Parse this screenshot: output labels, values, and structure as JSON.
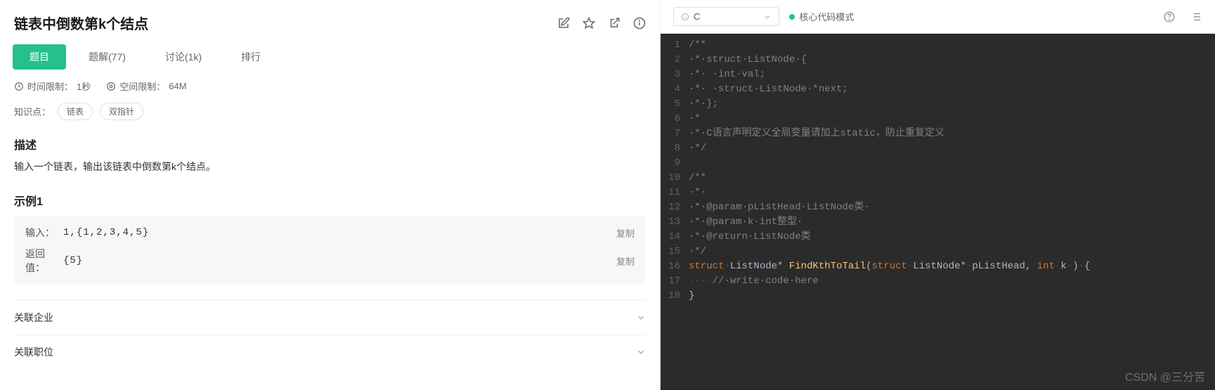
{
  "header": {
    "title": "链表中倒数第k个结点"
  },
  "tabs": [
    {
      "label": "题目",
      "active": true
    },
    {
      "label": "题解(77)",
      "active": false
    },
    {
      "label": "讨论(1k)",
      "active": false
    },
    {
      "label": "排行",
      "active": false
    }
  ],
  "limits": {
    "time_label": "时间限制：",
    "time_value": "1秒",
    "space_label": "空间限制：",
    "space_value": "64M"
  },
  "knowledge": {
    "label": "知识点：",
    "tags": [
      "链表",
      "双指针"
    ]
  },
  "description": {
    "heading": "描述",
    "text": "输入一个链表，输出该链表中倒数第k个结点。"
  },
  "example": {
    "heading": "示例1",
    "input_label": "输入：",
    "input_value": "1,{1,2,3,4,5}",
    "return_label": "返回值：",
    "return_value": "{5}",
    "copy_label": "复制"
  },
  "accordions": [
    "关联企业",
    "关联职位"
  ],
  "toolbar": {
    "language": "C",
    "mode_label": "核心代码模式"
  },
  "code": {
    "lines": [
      {
        "n": 1,
        "tokens": [
          {
            "t": "/**",
            "c": "cm"
          }
        ]
      },
      {
        "n": 2,
        "tokens": [
          {
            "t": "·*·struct·ListNode·{",
            "c": "cm"
          }
        ]
      },
      {
        "n": 3,
        "tokens": [
          {
            "t": "·*· ·int·val;",
            "c": "cm"
          }
        ]
      },
      {
        "n": 4,
        "tokens": [
          {
            "t": "·*· ·struct·ListNode·*next;",
            "c": "cm"
          }
        ]
      },
      {
        "n": 5,
        "tokens": [
          {
            "t": "·*·};",
            "c": "cm"
          }
        ]
      },
      {
        "n": 6,
        "tokens": [
          {
            "t": "·*",
            "c": "cm"
          }
        ]
      },
      {
        "n": 7,
        "tokens": [
          {
            "t": "·*·C语言声明定义全局变量请加上static，防止重复定义",
            "c": "cm"
          }
        ]
      },
      {
        "n": 8,
        "tokens": [
          {
            "t": "·*/",
            "c": "cm"
          }
        ]
      },
      {
        "n": 9,
        "tokens": [
          {
            "t": "",
            "c": "cm"
          }
        ]
      },
      {
        "n": 10,
        "tokens": [
          {
            "t": "/**",
            "c": "cm"
          }
        ]
      },
      {
        "n": 11,
        "tokens": [
          {
            "t": "·*·",
            "c": "cm"
          }
        ]
      },
      {
        "n": 12,
        "tokens": [
          {
            "t": "·*·@param·pListHead·ListNode类·",
            "c": "cm"
          }
        ]
      },
      {
        "n": 13,
        "tokens": [
          {
            "t": "·*·@param·k·int整型·",
            "c": "cm"
          }
        ]
      },
      {
        "n": 14,
        "tokens": [
          {
            "t": "·*·@return·ListNode类",
            "c": "cm"
          }
        ]
      },
      {
        "n": 15,
        "tokens": [
          {
            "t": "·*/",
            "c": "cm"
          }
        ]
      },
      {
        "n": 16,
        "tokens": [
          {
            "t": "struct",
            "c": "kw"
          },
          {
            "t": "·",
            "c": "sep"
          },
          {
            "t": "ListNode*",
            "c": "type"
          },
          {
            "t": "·",
            "c": "sep"
          },
          {
            "t": "FindKthToTail",
            "c": "fn"
          },
          {
            "t": "(",
            "c": "punc"
          },
          {
            "t": "struct",
            "c": "kw"
          },
          {
            "t": "·",
            "c": "sep"
          },
          {
            "t": "ListNode*",
            "c": "type"
          },
          {
            "t": "·",
            "c": "sep"
          },
          {
            "t": "pListHead",
            "c": "id"
          },
          {
            "t": ",",
            "c": "punc"
          },
          {
            "t": "·",
            "c": "sep"
          },
          {
            "t": "int",
            "c": "kw"
          },
          {
            "t": "·",
            "c": "sep"
          },
          {
            "t": "k",
            "c": "id"
          },
          {
            "t": "·",
            "c": "sep"
          },
          {
            "t": ")",
            "c": "punc"
          },
          {
            "t": "·",
            "c": "sep"
          },
          {
            "t": "{",
            "c": "punc"
          }
        ]
      },
      {
        "n": 17,
        "tokens": [
          {
            "t": "····",
            "c": "sep"
          },
          {
            "t": "//·write·code·here",
            "c": "cm"
          }
        ]
      },
      {
        "n": 18,
        "tokens": [
          {
            "t": "}",
            "c": "punc"
          }
        ]
      }
    ]
  },
  "watermark": "CSDN @三分苦"
}
